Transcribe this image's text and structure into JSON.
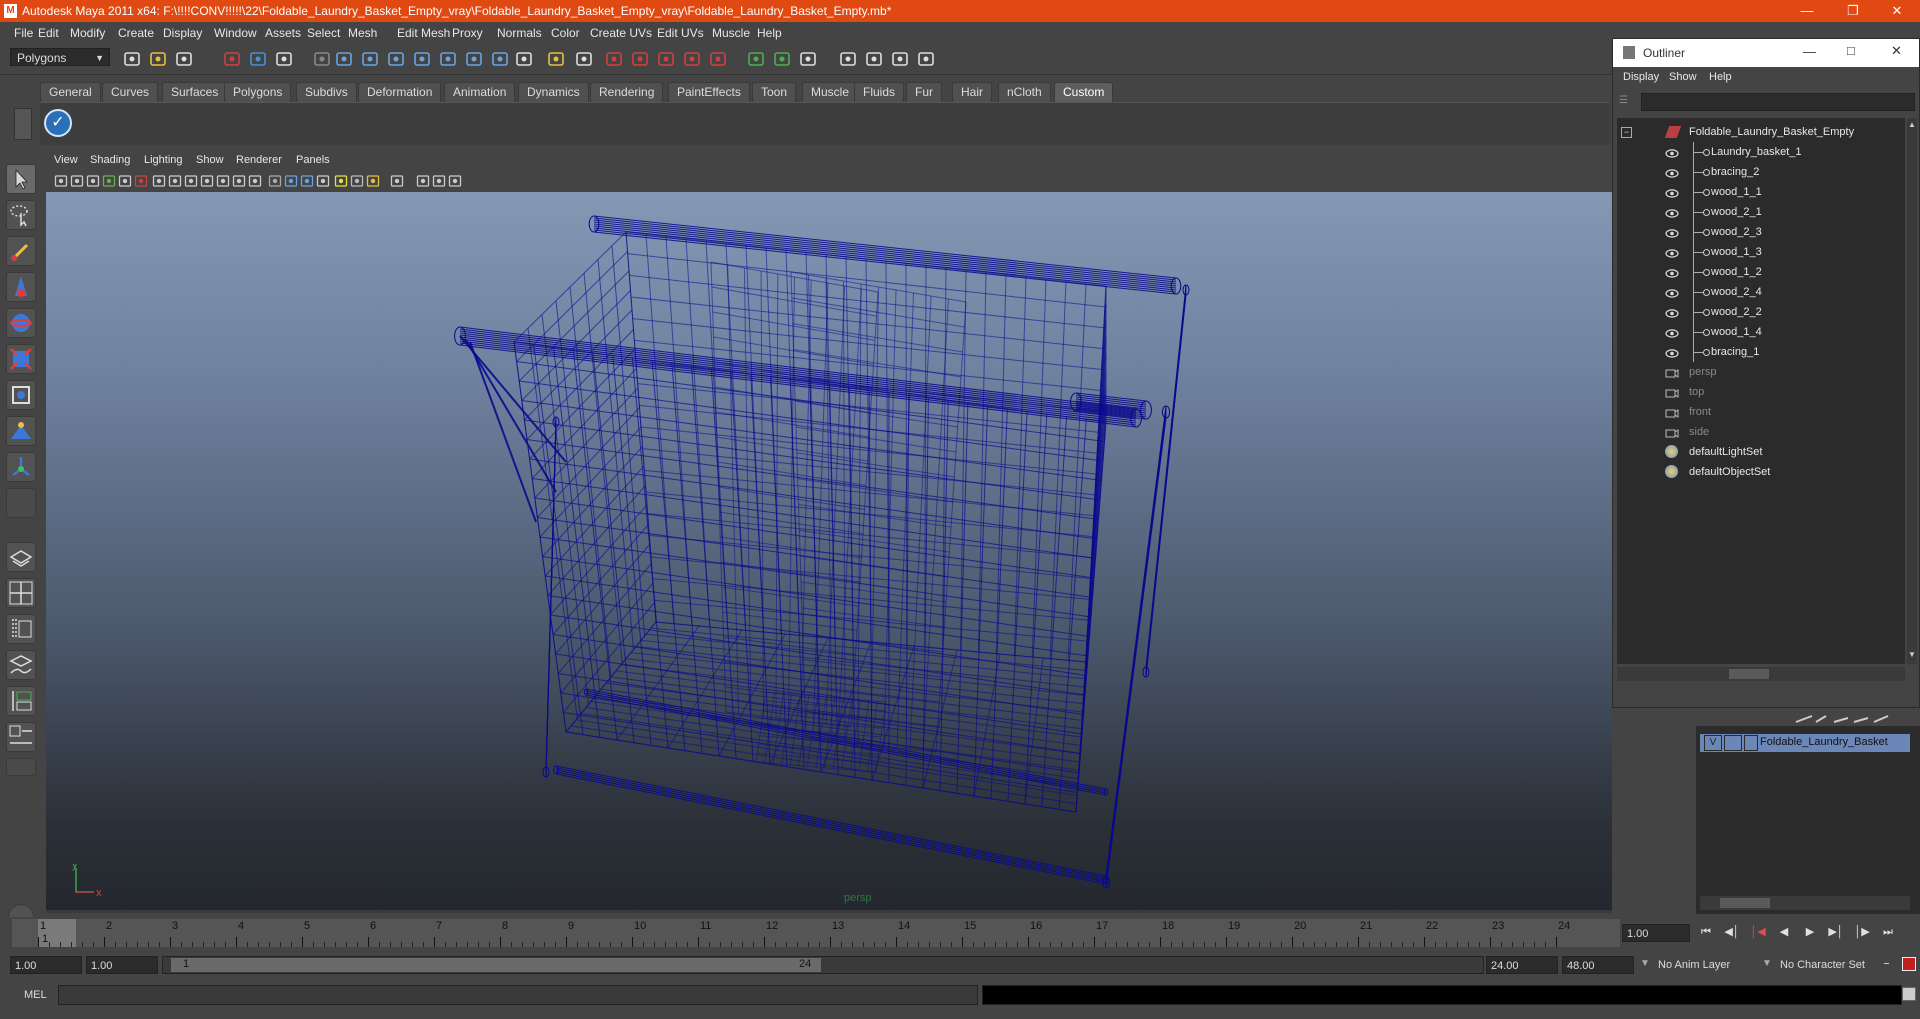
{
  "app": {
    "title": "Autodesk Maya 2011 x64: F:\\!!!!CONV!!!!!\\22\\Foldable_Laundry_Basket_Empty_vray\\Foldable_Laundry_Basket_Empty_vray\\Foldable_Laundry_Basket_Empty.mb*"
  },
  "menubar": [
    "File",
    "Edit",
    "Modify",
    "Create",
    "Display",
    "Window",
    "Assets",
    "Select",
    "Mesh",
    "Edit Mesh",
    "Proxy",
    "Normals",
    "Color",
    "Create UVs",
    "Edit UVs",
    "Muscle",
    "Help"
  ],
  "status_line": {
    "mode": "Polygons"
  },
  "shelf_tabs": [
    "General",
    "Curves",
    "Surfaces",
    "Polygons",
    "Subdivs",
    "Deformation",
    "Animation",
    "Dynamics",
    "Rendering",
    "PaintEffects",
    "Toon",
    "Muscle",
    "Fluids",
    "Fur",
    "Hair",
    "nCloth",
    "Custom"
  ],
  "shelf_active": "Custom",
  "panel_menu": [
    "View",
    "Shading",
    "Lighting",
    "Show",
    "Renderer",
    "Panels"
  ],
  "viewport": {
    "camera_label": "persp",
    "axis_x": "x",
    "axis_y": "y"
  },
  "outliner": {
    "title": "Outliner",
    "menu": [
      "Display",
      "Show",
      "Help"
    ],
    "items": [
      {
        "label": "Foldable_Laundry_Basket_Empty",
        "kind": "root"
      },
      {
        "label": "Laundry_basket_1",
        "kind": "child"
      },
      {
        "label": "bracing_2",
        "kind": "child"
      },
      {
        "label": "wood_1_1",
        "kind": "child"
      },
      {
        "label": "wood_2_1",
        "kind": "child"
      },
      {
        "label": "wood_2_3",
        "kind": "child"
      },
      {
        "label": "wood_1_3",
        "kind": "child"
      },
      {
        "label": "wood_1_2",
        "kind": "child"
      },
      {
        "label": "wood_2_4",
        "kind": "child"
      },
      {
        "label": "wood_2_2",
        "kind": "child"
      },
      {
        "label": "wood_1_4",
        "kind": "child"
      },
      {
        "label": "bracing_1",
        "kind": "child"
      },
      {
        "label": "persp",
        "kind": "cam"
      },
      {
        "label": "top",
        "kind": "cam"
      },
      {
        "label": "front",
        "kind": "cam"
      },
      {
        "label": "side",
        "kind": "cam"
      },
      {
        "label": "defaultLightSet",
        "kind": "set"
      },
      {
        "label": "defaultObjectSet",
        "kind": "set"
      }
    ]
  },
  "layer": {
    "visible": "V",
    "name": "Foldable_Laundry_Basket"
  },
  "timeline": {
    "ticks": [
      "1",
      "2",
      "3",
      "4",
      "5",
      "6",
      "7",
      "8",
      "9",
      "10",
      "11",
      "12",
      "13",
      "14",
      "15",
      "16",
      "17",
      "18",
      "19",
      "20",
      "21",
      "22",
      "23",
      "24"
    ],
    "current_frame": "1",
    "current_time_field": "1.00"
  },
  "range": {
    "start": "1.00",
    "playback_start": "1.00",
    "slider_start": "1",
    "slider_end": "24",
    "playback_end": "24.00",
    "end": "48.00",
    "anim_layer": "No Anim Layer",
    "character_set": "No Character Set"
  },
  "command": {
    "label": "MEL"
  },
  "colors": {
    "title_bar": "#e04a12",
    "wireframe": "#0a0a8c"
  }
}
